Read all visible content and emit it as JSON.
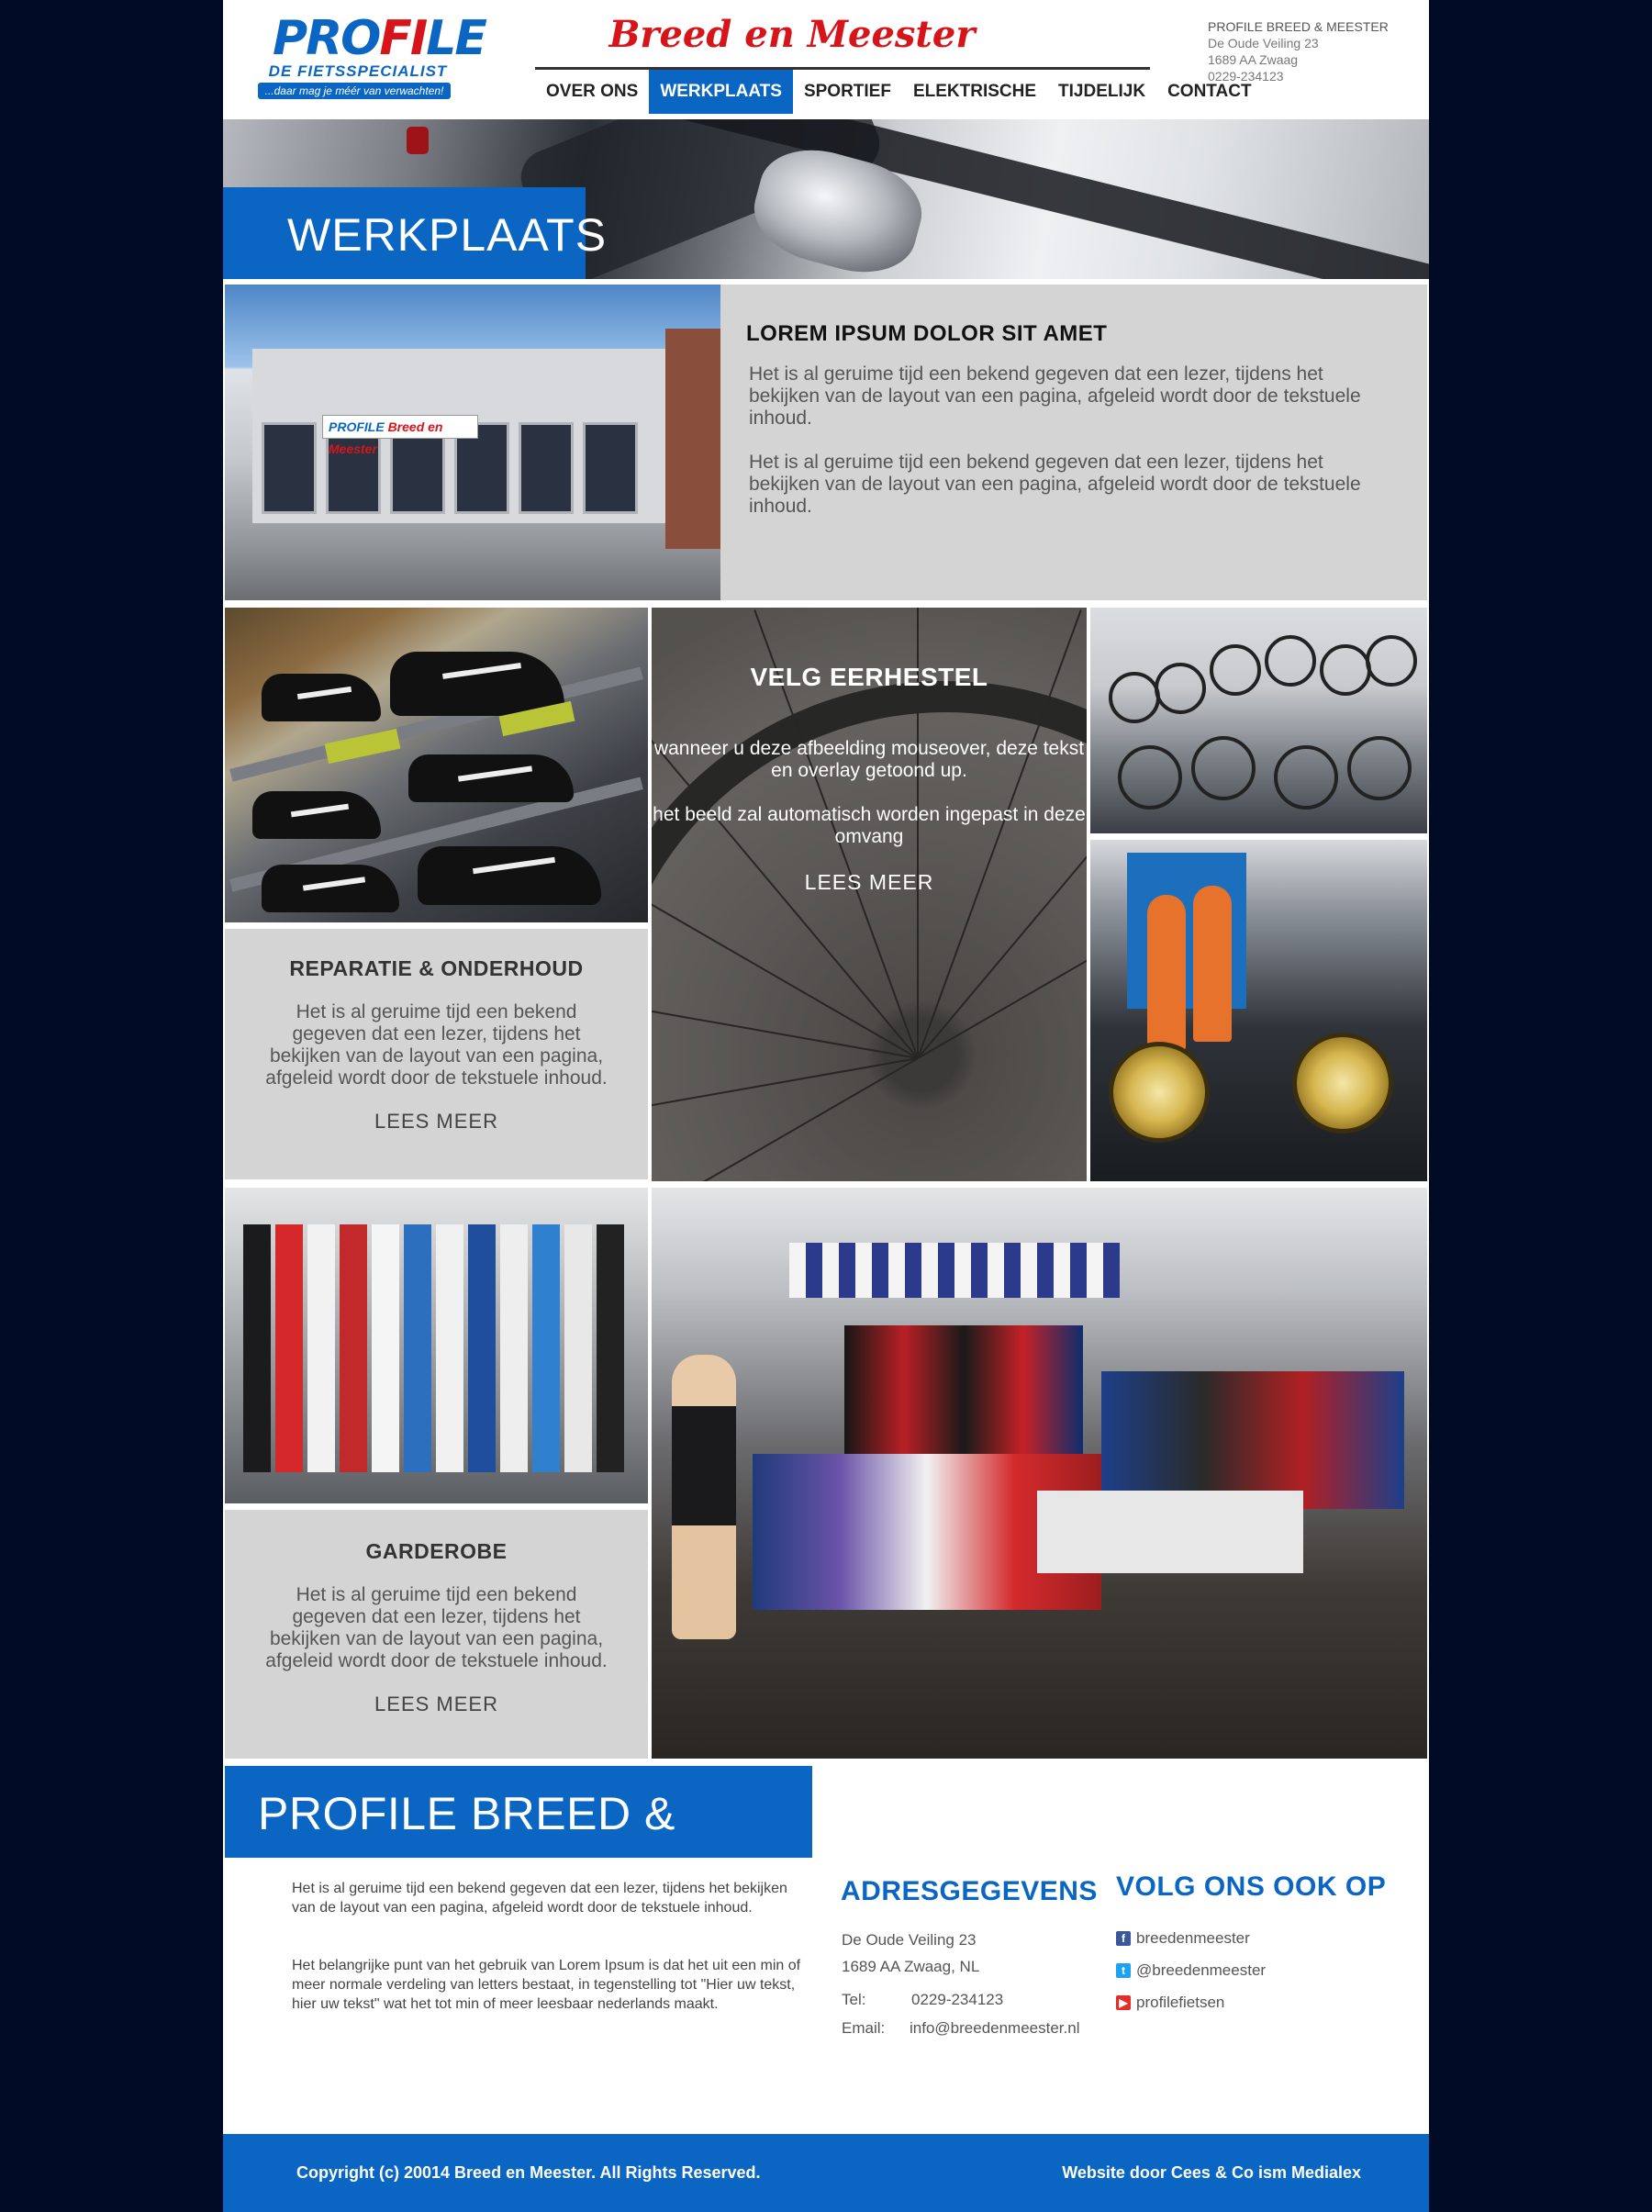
{
  "header": {
    "logo": {
      "main": "PROFILE",
      "sub": "DE FIETSSPECIALIST",
      "tagline": "...daar mag je méér van verwachten!"
    },
    "brand": "Breed en Meester",
    "address": [
      "PROFILE BREED & MEESTER",
      "De Oude Veiling 23",
      "1689 AA Zwaag",
      "0229-234123"
    ],
    "nav": [
      "OVER ONS",
      "WERKPLAATS",
      "SPORTIEF",
      "ELEKTRISCHE",
      "TIJDELIJK",
      "CONTACT"
    ],
    "active_nav": "WERKPLAATS"
  },
  "hero": {
    "title": "WERKPLAATS"
  },
  "intro": {
    "store_sign": {
      "brand": "PROFILE",
      "sub": "Breed en Meester"
    },
    "title": "LOREM IPSUM DOLOR SIT AMET",
    "p1": "Het is al geruime tijd een bekend gegeven dat een lezer, tijdens het bekijken van de layout van een pagina, afgeleid wordt door de tekstuele inhoud.",
    "p2": "Het is al geruime tijd een bekend gegeven dat een lezer, tijdens het bekijken van de layout van een pagina, afgeleid wordt door de tekstuele inhoud."
  },
  "cards": {
    "reparatie": {
      "title": "REPARATIE & ONDERHOUD",
      "text": "Het is al geruime tijd een bekend gegeven dat een lezer, tijdens het bekijken van de layout van een pagina, afgeleid wordt door de tekstuele inhoud.",
      "more": "LEES MEER"
    },
    "velg": {
      "title": "VELG EERHESTEL",
      "text1": "wanneer u deze afbeelding mouseover, deze tekst en overlay getoond up.",
      "text2": "het beeld zal automatisch worden ingepast in deze omvang",
      "more": "LEES MEER"
    },
    "garderobe": {
      "title": "GARDEROBE",
      "text": "Het is al geruime tijd een bekend gegeven dat een lezer, tijdens het bekijken van de layout van een pagina, afgeleid wordt door de tekstuele inhoud.",
      "more": "LEES MEER"
    }
  },
  "bottom": {
    "banner": "PROFILE BREED & MEESTER",
    "p1": "Het is al geruime tijd een bekend gegeven dat een lezer, tijdens het bekijken van de layout van een pagina, afgeleid wordt door de tekstuele inhoud.",
    "p2": "Het belangrijke punt van het gebruik van Lorem Ipsum is dat het uit een min of meer normale verdeling van letters bestaat, in tegenstelling tot \"Hier uw tekst, hier uw tekst\" wat het tot min of meer leesbaar nederlands maakt.",
    "address_title": "ADRESGEGEVENS",
    "street": "De Oude Veiling 23",
    "city": "1689 AA Zwaag, NL",
    "tel_label": "Tel:",
    "tel": "0229-234123",
    "email_label": "Email:",
    "email": "info@breedenmeester.nl",
    "social_title": "VOLG ONS OOK OP",
    "social": [
      {
        "icon": "facebook-icon",
        "label": "breedenmeester",
        "color": "#3b5998"
      },
      {
        "icon": "twitter-icon",
        "label": "@breedenmeester",
        "color": "#1da1f2"
      },
      {
        "icon": "youtube-icon",
        "label": "profilefietsen",
        "color": "#e52d27"
      }
    ]
  },
  "footer": {
    "copyright": "Copyright (c) 20014  Breed en Meester. All Rights Reserved.",
    "credit": "Website door Cees & Co ism Medialex"
  },
  "colors": {
    "brand_blue": "#0b66c3",
    "brand_red": "#d6151b",
    "panel_gray": "#d4d4d4",
    "background": "#020b26"
  }
}
